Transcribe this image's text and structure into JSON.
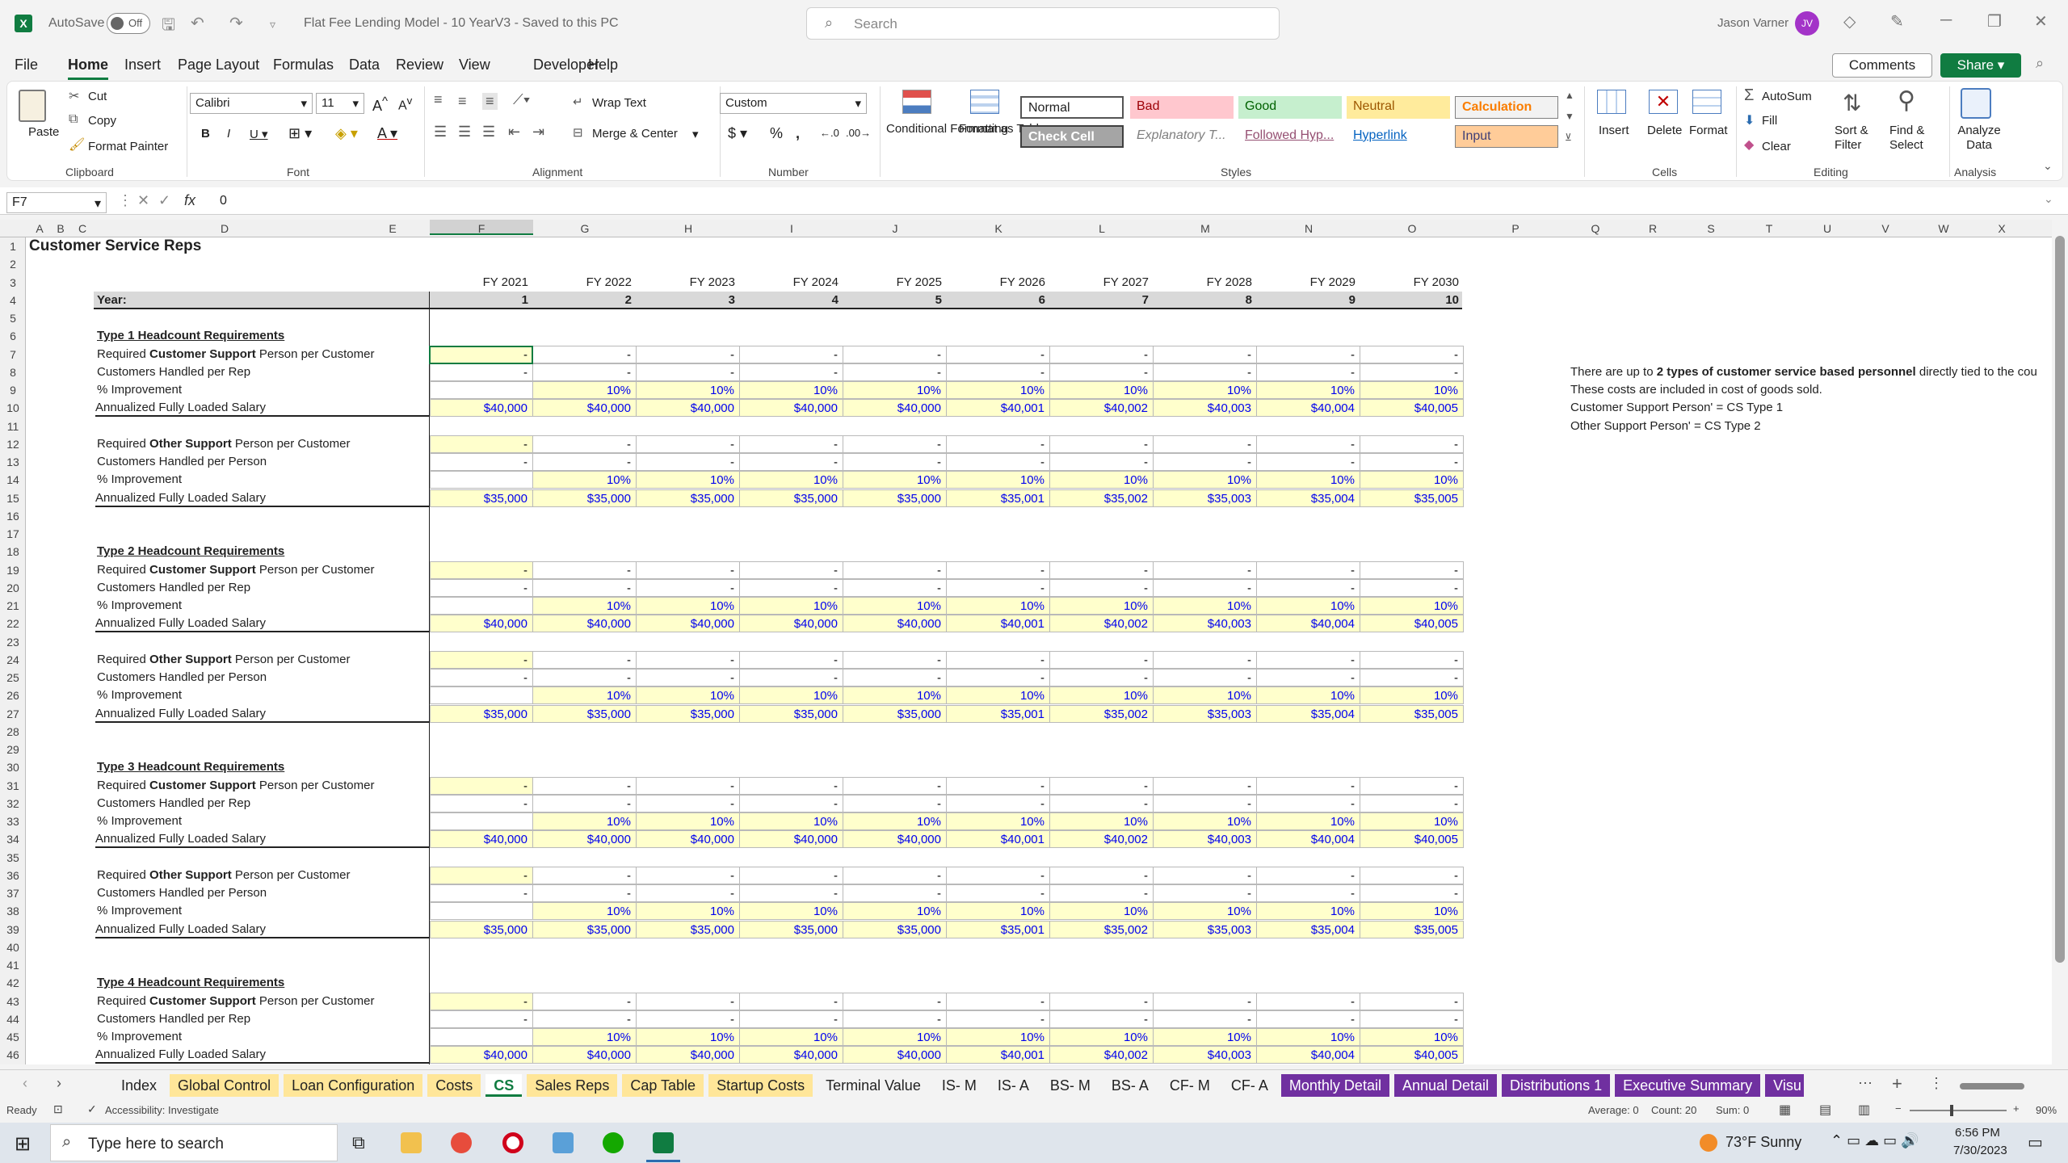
{
  "titlebar": {
    "autosave_label": "AutoSave",
    "autosave_state": "Off",
    "doc_title": "Flat Fee Lending Model - 10 YearV3  -  Saved to this PC",
    "search_placeholder": "Search",
    "user_name": "Jason Varner",
    "user_initials": "JV"
  },
  "menu": [
    "File",
    "Home",
    "Insert",
    "Page Layout",
    "Formulas",
    "Data",
    "Review",
    "View",
    "Developer",
    "Help"
  ],
  "menu_active": "Home",
  "comments_label": "Comments",
  "share_label": "Share",
  "ribbon": {
    "clipboard": {
      "paste": "Paste",
      "cut": "Cut",
      "copy": "Copy",
      "format_painter": "Format Painter",
      "group": "Clipboard"
    },
    "font": {
      "name": "Calibri",
      "size": "11",
      "group": "Font"
    },
    "alignment": {
      "wrap": "Wrap Text",
      "merge": "Merge & Center",
      "group": "Alignment"
    },
    "number": {
      "format": "Custom",
      "group": "Number"
    },
    "styles": {
      "conditional": "Conditional Formatting",
      "format_table": "Format as Table",
      "group": "Styles",
      "normal": "Normal",
      "bad": "Bad",
      "good": "Good",
      "neutral": "Neutral",
      "calculation": "Calculation",
      "check_cell": "Check Cell",
      "explanatory": "Explanatory T...",
      "followed": "Followed Hyp...",
      "hyperlink": "Hyperlink",
      "input": "Input"
    },
    "cells": {
      "insert": "Insert",
      "delete": "Delete",
      "format": "Format",
      "group": "Cells"
    },
    "editing": {
      "autosum": "AutoSum",
      "fill": "Fill",
      "clear": "Clear",
      "sort": "Sort & Filter",
      "find": "Find & Select",
      "group": "Editing"
    },
    "analysis": {
      "analyze": "Analyze Data",
      "group": "Analysis"
    },
    "colors": {
      "bad_bg": "#ffc7ce",
      "bad_fg": "#9c0006",
      "good_bg": "#c6efce",
      "good_fg": "#006100",
      "neutral_bg": "#ffeb9c",
      "neutral_fg": "#9c5700",
      "calc_bg": "#f2f2f2",
      "calc_fg": "#fa7d00",
      "input_bg": "#ffcc99",
      "input_fg": "#3f3f76",
      "check_bg": "#a5a5a5"
    }
  },
  "formula_bar": {
    "name_box": "F7",
    "fx": "fx",
    "value": "0"
  },
  "columns": [
    "A",
    "B",
    "C",
    "D",
    "E",
    "F",
    "G",
    "H",
    "I",
    "J",
    "K",
    "L",
    "M",
    "N",
    "O",
    "P",
    "Q",
    "R",
    "S",
    "T",
    "U",
    "V",
    "W",
    "X"
  ],
  "sheet": {
    "title": "Customer Service Reps",
    "year_label": "Year:",
    "fy_labels": [
      "FY 2021",
      "FY 2022",
      "FY 2023",
      "FY 2024",
      "FY 2025",
      "FY 2026",
      "FY 2027",
      "FY 2028",
      "FY 2029",
      "FY 2030"
    ],
    "years": [
      "1",
      "2",
      "3",
      "4",
      "5",
      "6",
      "7",
      "8",
      "9",
      "10"
    ],
    "notes": [
      "There are up to 2 types of customer service based personnel directly tied to the cou",
      "These costs are included in cost of goods sold.",
      "Customer Support Person' = CS Type 1",
      "Other Support Person' = CS Type 2"
    ],
    "sections": [
      {
        "title": "Type 1 Headcount Requirements",
        "blocks": [
          {
            "l1": "Required Customer Support Person per Customer",
            "l2": "Customers Handled per Rep",
            "l3": "% Improvement",
            "l4": "Annualized Fully Loaded Salary",
            "salary": [
              "$40,000",
              "$40,000",
              "$40,000",
              "$40,000",
              "$40,000",
              "$40,001",
              "$40,002",
              "$40,003",
              "$40,004",
              "$40,005"
            ]
          },
          {
            "l1": "Required Other Support Person per Customer",
            "l2": "Customers Handled per Person",
            "l3": "% Improvement",
            "l4": "Annualized Fully Loaded Salary",
            "salary": [
              "$35,000",
              "$35,000",
              "$35,000",
              "$35,000",
              "$35,000",
              "$35,001",
              "$35,002",
              "$35,003",
              "$35,004",
              "$35,005"
            ]
          }
        ]
      },
      {
        "title": "Type 2 Headcount Requirements",
        "blocks": [
          {
            "l1": "Required Customer Support Person per Customer",
            "l2": "Customers Handled per Rep",
            "l3": "% Improvement",
            "l4": "Annualized Fully Loaded Salary",
            "salary": [
              "$40,000",
              "$40,000",
              "$40,000",
              "$40,000",
              "$40,000",
              "$40,001",
              "$40,002",
              "$40,003",
              "$40,004",
              "$40,005"
            ]
          },
          {
            "l1": "Required Other Support Person per Customer",
            "l2": "Customers Handled per Person",
            "l3": "% Improvement",
            "l4": "Annualized Fully Loaded Salary",
            "salary": [
              "$35,000",
              "$35,000",
              "$35,000",
              "$35,000",
              "$35,000",
              "$35,001",
              "$35,002",
              "$35,003",
              "$35,004",
              "$35,005"
            ]
          }
        ]
      },
      {
        "title": "Type 3 Headcount Requirements",
        "blocks": [
          {
            "l1": "Required Customer Support Person per Customer",
            "l2": "Customers Handled per Rep",
            "l3": "% Improvement",
            "l4": "Annualized Fully Loaded Salary",
            "salary": [
              "$40,000",
              "$40,000",
              "$40,000",
              "$40,000",
              "$40,000",
              "$40,001",
              "$40,002",
              "$40,003",
              "$40,004",
              "$40,005"
            ]
          },
          {
            "l1": "Required Other Support Person per Customer",
            "l2": "Customers Handled per Person",
            "l3": "% Improvement",
            "l4": "Annualized Fully Loaded Salary",
            "salary": [
              "$35,000",
              "$35,000",
              "$35,000",
              "$35,000",
              "$35,000",
              "$35,001",
              "$35,002",
              "$35,003",
              "$35,004",
              "$35,005"
            ]
          }
        ]
      },
      {
        "title": "Type 4 Headcount Requirements",
        "blocks": [
          {
            "l1": "Required Customer Support Person per Customer",
            "l2": "Customers Handled per Rep",
            "l3": "% Improvement",
            "l4": "Annualized Fully Loaded Salary",
            "salary": [
              "$40,000",
              "$40,000",
              "$40,000",
              "$40,000",
              "$40,000",
              "$40,001",
              "$40,002",
              "$40,003",
              "$40,004",
              "$40,005"
            ]
          }
        ]
      }
    ],
    "dash": "-",
    "pct": "10%"
  },
  "tabs": [
    {
      "label": "Index",
      "style": "plain"
    },
    {
      "label": "Global Control",
      "style": "yellow"
    },
    {
      "label": "Loan Configuration",
      "style": "yellow"
    },
    {
      "label": "Costs",
      "style": "yellow"
    },
    {
      "label": "CS",
      "style": "active"
    },
    {
      "label": "Sales Reps",
      "style": "yellow"
    },
    {
      "label": "Cap Table",
      "style": "yellow"
    },
    {
      "label": "Startup Costs",
      "style": "yellow"
    },
    {
      "label": "Terminal Value",
      "style": "plain"
    },
    {
      "label": "IS- M",
      "style": "plain"
    },
    {
      "label": "IS- A",
      "style": "plain"
    },
    {
      "label": "BS- M",
      "style": "plain"
    },
    {
      "label": "BS- A",
      "style": "plain"
    },
    {
      "label": "CF- M",
      "style": "plain"
    },
    {
      "label": "CF- A",
      "style": "plain"
    },
    {
      "label": "Monthly Detail",
      "style": "purple"
    },
    {
      "label": "Annual Detail",
      "style": "purple"
    },
    {
      "label": "Distributions 1",
      "style": "purple"
    },
    {
      "label": "Executive Summary",
      "style": "purple"
    },
    {
      "label": "Visu",
      "style": "purple"
    }
  ],
  "status": {
    "ready": "Ready",
    "accessibility": "Accessibility: Investigate",
    "average": "Average: 0",
    "count": "Count: 20",
    "sum": "Sum: 0",
    "zoom": "90%"
  },
  "taskbar": {
    "search": "Type here to search",
    "weather": "73°F  Sunny",
    "time": "6:56 PM",
    "date": "7/30/2023"
  }
}
